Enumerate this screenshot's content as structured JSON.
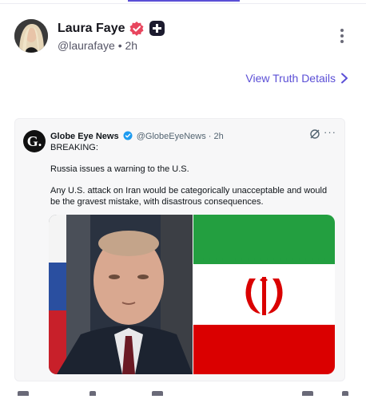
{
  "post": {
    "author_name": "Laura Faye",
    "handle": "@laurafaye",
    "separator": "•",
    "time": "2h"
  },
  "truth_details_label": "View Truth Details",
  "quoted_tweet": {
    "logo_letter": "G.",
    "name": "Globe Eye News",
    "handle": "@GlobeEyeNews",
    "separator": "·",
    "time": "2h",
    "more": "···",
    "lines": [
      "BREAKING:",
      "Russia issues a warning to the U.S.",
      "Any U.S. attack on Iran would be categorically unacceptable and would be the gravest mistake, with disastrous consequences."
    ]
  },
  "colors": {
    "accent": "#5b4fd6",
    "verified_badge": "#e8465e",
    "twitter_blue": "#1d9bf0",
    "iran_green": "#239f40",
    "iran_red": "#da0000"
  },
  "icons": [
    "verified-badge-icon",
    "plus-badge-icon",
    "more-vertical-icon",
    "chevron-right-icon",
    "twitter-verified-icon",
    "grok-icon"
  ]
}
